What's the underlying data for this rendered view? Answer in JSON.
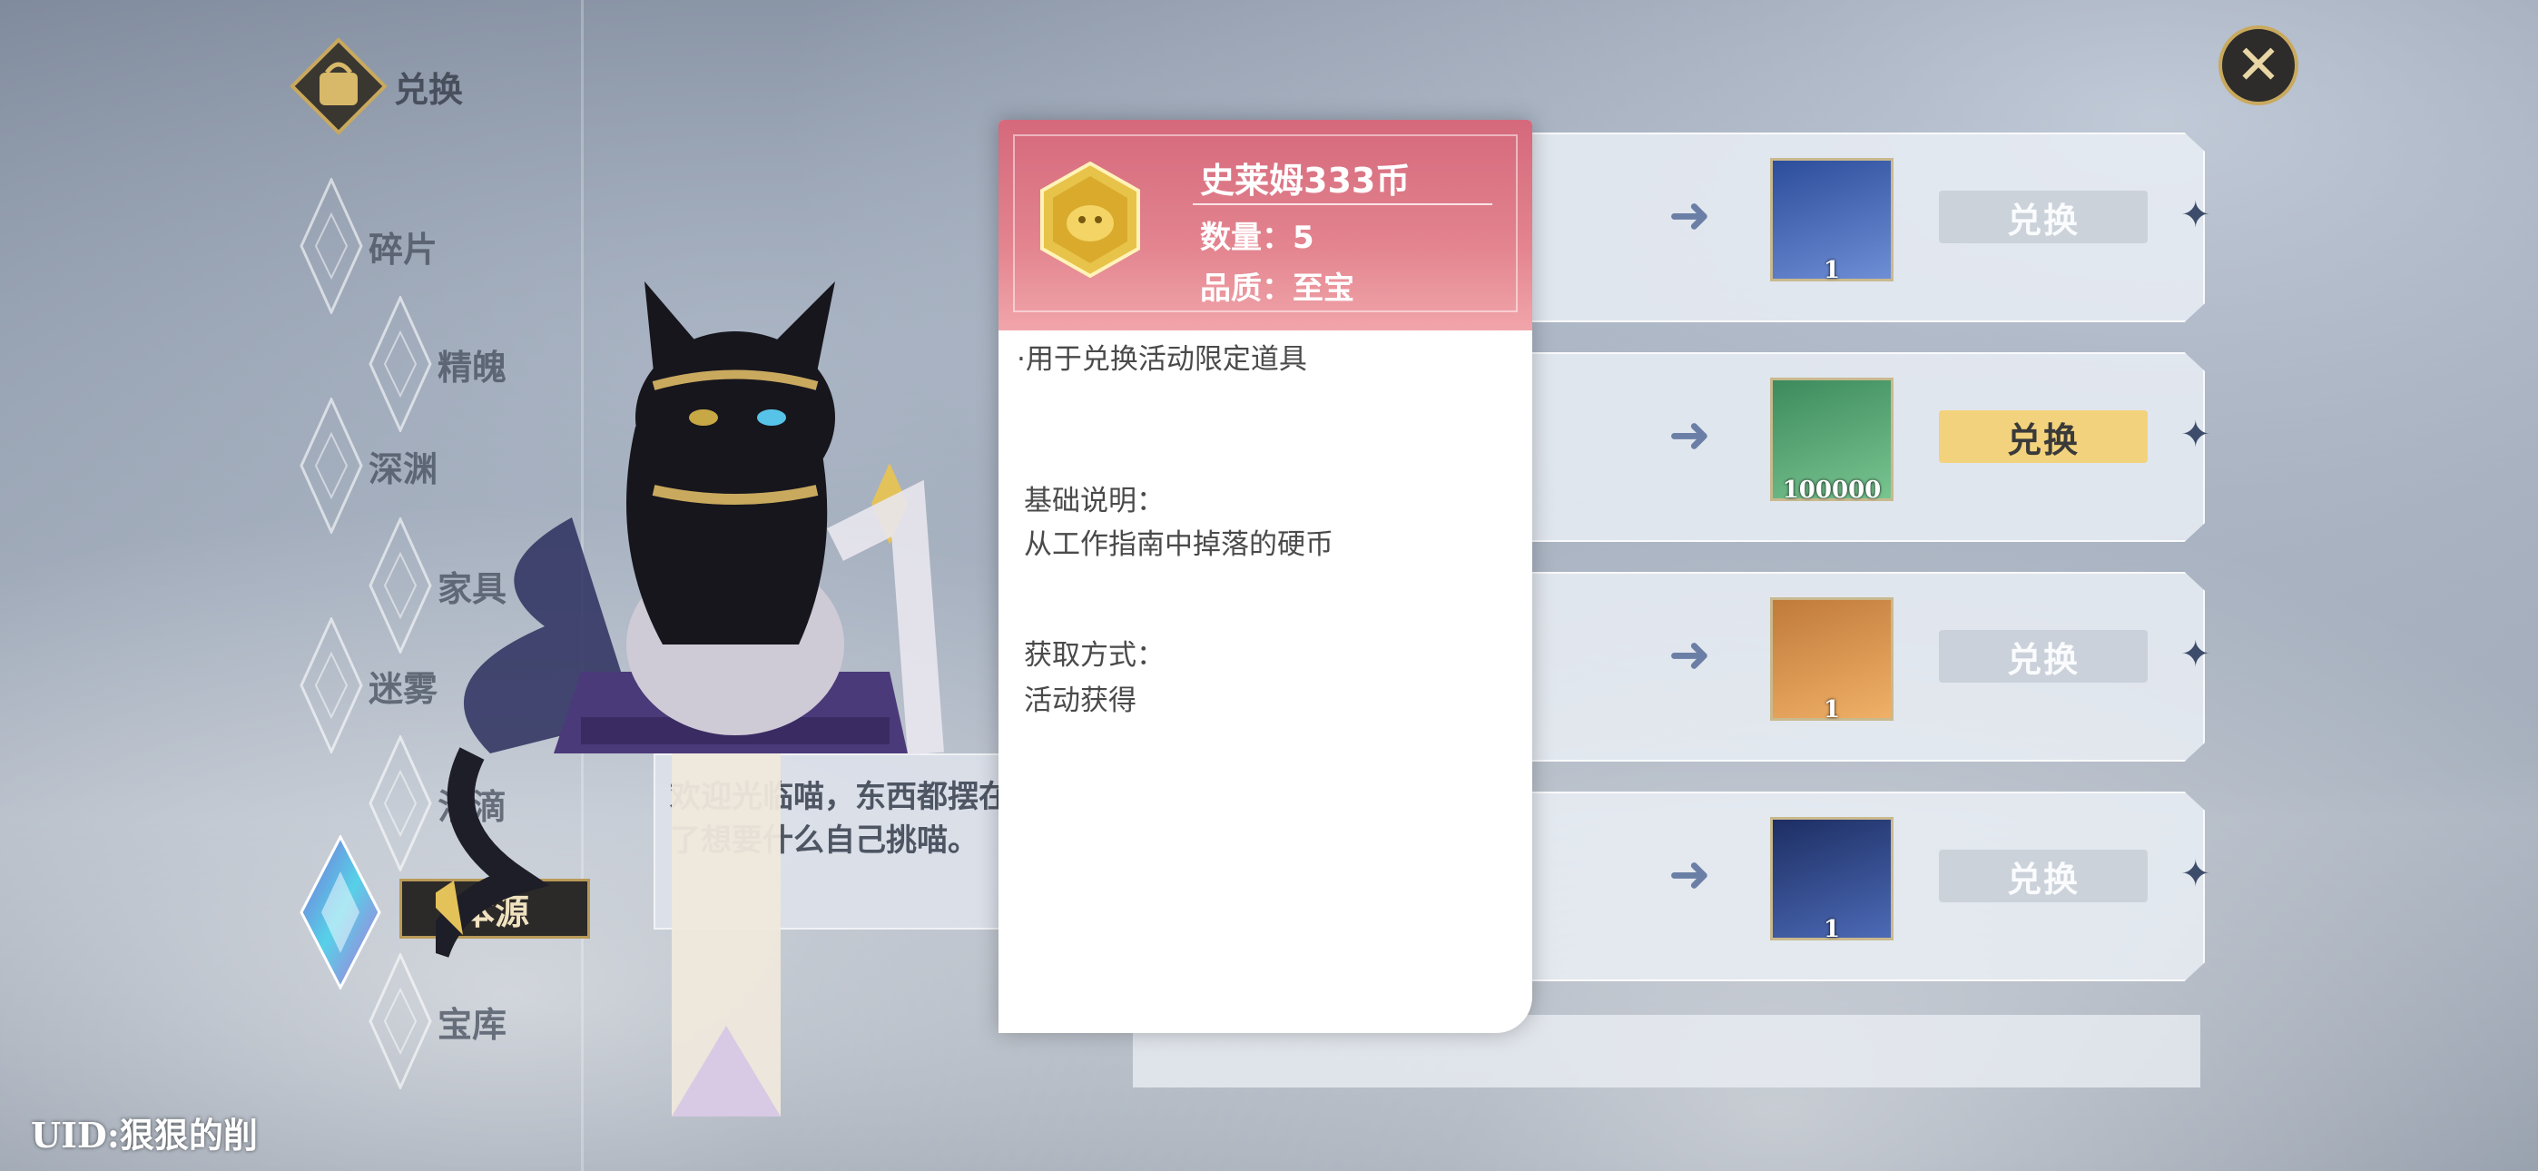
{
  "nav": {
    "exchange": "兑换",
    "items": [
      {
        "label": "碎片"
      },
      {
        "label": "精魄"
      },
      {
        "label": "深渊"
      },
      {
        "label": "家具"
      },
      {
        "label": "迷雾"
      },
      {
        "label": "泪滴"
      },
      {
        "label": "本源"
      },
      {
        "label": "宝库"
      }
    ],
    "active": "本源"
  },
  "dialog": {
    "line1": "欢迎光临喵，东西都摆在",
    "line2": "了想要什么自己挑喵。"
  },
  "popup": {
    "name": "史莱姆333币",
    "quantity": "数量：5",
    "quality": "品质：至宝",
    "desc": "·用于兑换活动限定道具",
    "basic_title": "基础说明：",
    "basic_text": "从工作指南中掉落的硬币",
    "obtain_title": "获取方式：",
    "obtain_text": "活动获得"
  },
  "shop": {
    "rows": [
      {
        "count": "1",
        "button": "兑换",
        "state": "disabled",
        "icon": "golden-bird-icon"
      },
      {
        "count": "100000",
        "button": "兑换",
        "state": "active",
        "icon": "gold-coin-icon"
      },
      {
        "count": "1",
        "button": "兑换",
        "state": "disabled",
        "icon": "blue-orb-icon"
      },
      {
        "count": "1",
        "button": "兑换",
        "state": "disabled",
        "icon": "server-rack-icon"
      }
    ]
  },
  "uid": "UID:狠狠的削",
  "colors": {
    "accent_gold": "#c9a95e",
    "popup_header": "#d5697c",
    "active_button": "#f2d27c"
  }
}
